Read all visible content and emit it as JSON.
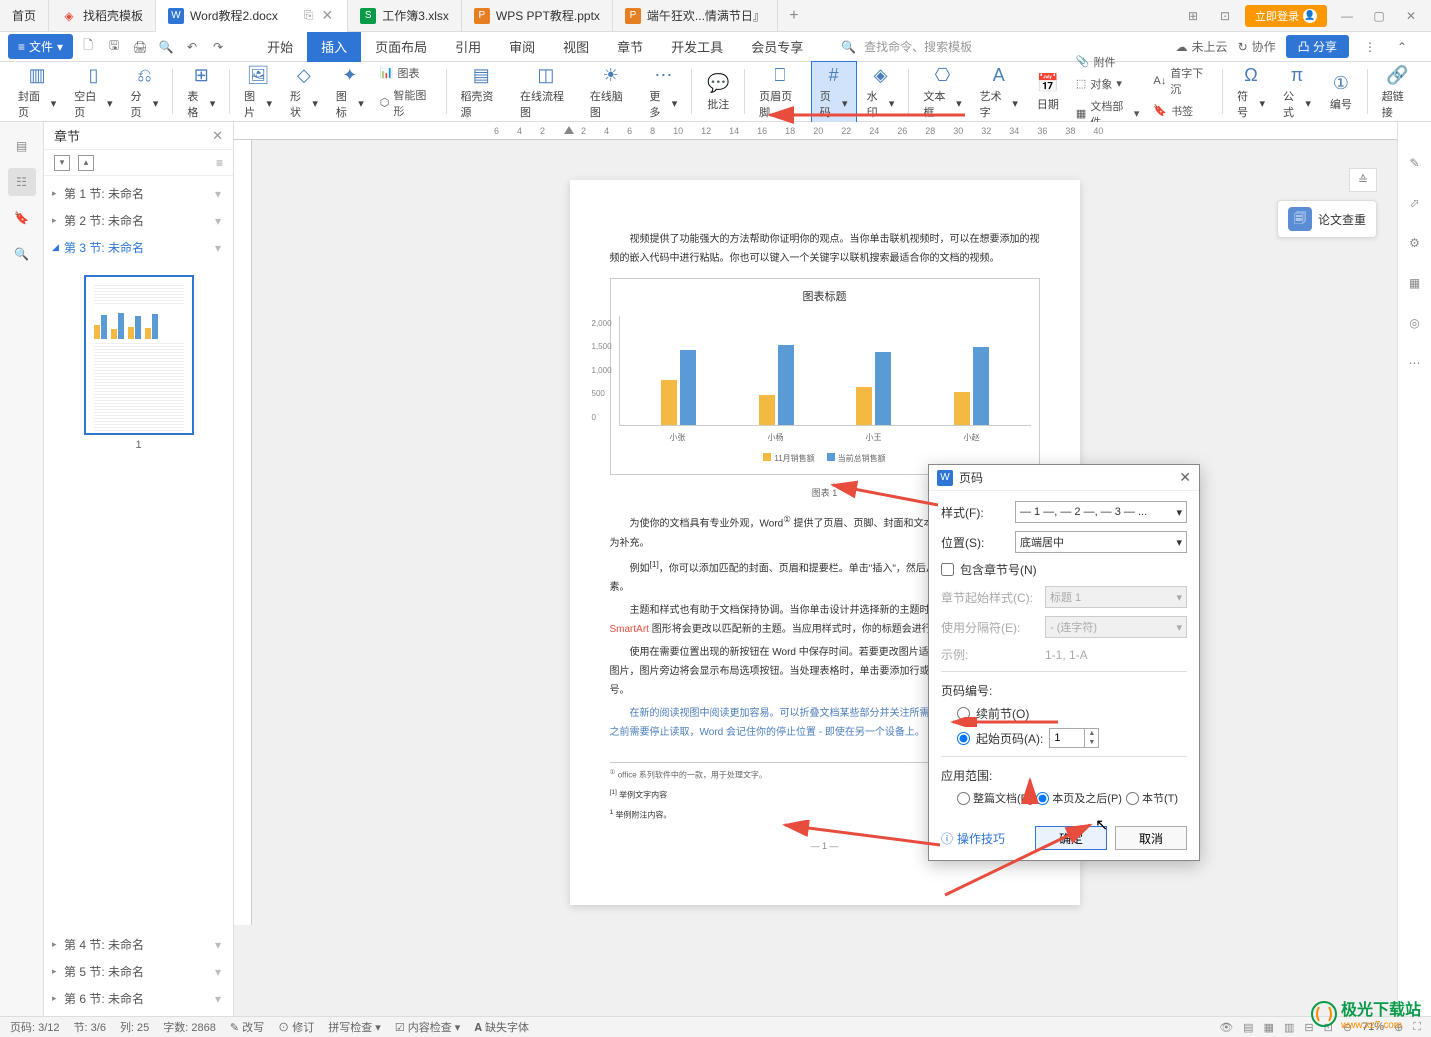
{
  "tabs": [
    {
      "label": "首页",
      "active": false
    },
    {
      "label": "找稻壳模板",
      "icon": "🔥",
      "iconColor": "#e74c3c",
      "active": false
    },
    {
      "label": "Word教程2.docx",
      "icon": "W",
      "iconColor": "#2e75d5",
      "active": true
    },
    {
      "label": "工作簿3.xlsx",
      "icon": "S",
      "iconColor": "#0a9b4a",
      "active": false
    },
    {
      "label": "WPS PPT教程.pptx",
      "icon": "P",
      "iconColor": "#e67e22",
      "active": false
    },
    {
      "label": "端午狂欢...情满节日』",
      "icon": "P",
      "iconColor": "#e67e22",
      "active": false
    }
  ],
  "login_label": "立即登录",
  "file_menu": "文件",
  "menu_tabs": [
    "开始",
    "插入",
    "页面布局",
    "引用",
    "审阅",
    "视图",
    "章节",
    "开发工具",
    "会员专享"
  ],
  "menu_active": "插入",
  "search_placeholder": "查找命令、搜索模板",
  "cloud": "未上云",
  "coop": "协作",
  "share": "分享",
  "ribbon": {
    "cover": "封面页",
    "blank": "空白页",
    "break": "分页",
    "table": "表格",
    "pic": "图片",
    "shape": "形状",
    "icon": "图标",
    "daokelib": "稻壳资源",
    "flowchart": "在线流程图",
    "mindmap": "在线脑图",
    "more": "更多",
    "comment": "批注",
    "header": "页眉页脚",
    "pagenum": "页码",
    "watermark": "水印",
    "textbox": "文本框",
    "wordart": "艺术字",
    "date": "日期",
    "attach": "附件",
    "object": "对象",
    "docparts": "文档部件",
    "bookmark": "书签",
    "link": "超链接",
    "firstdrop": "首字下沉",
    "symbol": "符号",
    "formula": "公式",
    "num": "编号",
    "smartart": "智能图形",
    "chart": "图表"
  },
  "sidebar": {
    "title": "章节",
    "sections": [
      {
        "label": "第 1 节: 未命名"
      },
      {
        "label": "第 2 节: 未命名"
      },
      {
        "label": "第 3 节: 未命名",
        "active": true
      },
      {
        "label": "第 4 节: 未命名"
      },
      {
        "label": "第 5 节: 未命名"
      },
      {
        "label": "第 6 节: 未命名"
      }
    ],
    "thumb_num": "1"
  },
  "doc": {
    "para1": "视频提供了功能强大的方法帮助你证明你的观点。当你单击联机视频时，可以在想要添加的视频的嵌入代码中进行粘贴。你也可以键入一个关键字以联机搜索最适合你的文档的视频。",
    "para2_a": "为使你的文档具有专业外观，Word",
    "para2_b": " 提供了页眉、页脚、封面和文本框设计，这些设计可互为补充。",
    "para3": "例如，你可以添加匹配的封面、页眉和提要栏。单击\"插入\"，然后从不同库中选择所需元素。",
    "para4": "主题和样式也有助于文档保持协调。当你单击设计并选择新的主题时，图片、图表或 SmartArt 图形将会更改以匹配新的主题。当应用样式时，你的标题会进行更改以匹配新的主题。",
    "para5": "使用在需要位置出现的新按钮在 Word 中保存时间。若要更改图片适应文档的方式，请单击该图片，图片旁边将会显示布局选项按钮。当处理表格时，单击要添加行或列的位置，然后单击加号。",
    "para6": "在新的阅读视图中阅读更加容易。可以折叠文档某些部分并关注所需文本。如果在达到结尾处之前需要停止读取，Word 会记住你的停止位置 - 即使在另一个设备上。",
    "footnote1": "office 系列软件中的一款，用于处理文字。",
    "footnote2": "举例文字内容",
    "footnote3": "举例附注内容。",
    "fig_caption": "图表 1",
    "page_num": "— 1 —"
  },
  "chart_data": {
    "type": "bar",
    "title": "图表标题",
    "categories": [
      "小张",
      "小杨",
      "小王",
      "小赵"
    ],
    "series": [
      {
        "name": "11月销售额",
        "values": [
          900,
          600,
          750,
          650
        ],
        "color": "#f4b942"
      },
      {
        "name": "当前总销售额",
        "values": [
          1500,
          1600,
          1450,
          1550
        ],
        "color": "#5b9bd5"
      }
    ],
    "ylim": [
      0,
      2000
    ],
    "yticks": [
      0,
      500,
      1000,
      1500,
      2000
    ]
  },
  "float_check": "论文查重",
  "dialog": {
    "title": "页码",
    "style_label": "样式(F):",
    "style_value": "— 1 —, — 2 —, — 3 — ...",
    "pos_label": "位置(S):",
    "pos_value": "底端居中",
    "include_chapter": "包含章节号(N)",
    "chapter_style_label": "章节起始样式(C):",
    "chapter_style_value": "标题 1",
    "separator_label": "使用分隔符(E):",
    "separator_value": "- (连字符)",
    "example_label": "示例:",
    "example_value": "1-1, 1-A",
    "numbering_hdr": "页码编号:",
    "continue_label": "续前节(O)",
    "start_label": "起始页码(A):",
    "start_value": "1",
    "scope_hdr": "应用范围:",
    "scope_whole": "整篇文档(D)",
    "scope_after": "本页及之后(P)",
    "scope_section": "本节(T)",
    "help": "操作技巧",
    "ok": "确定",
    "cancel": "取消"
  },
  "statusbar": {
    "page": "页码: 3/12",
    "section": "节: 3/6",
    "col": "列: 25",
    "words": "字数: 2868",
    "track": "改写",
    "revise": "修订",
    "spell": "拼写检查",
    "content": "内容检查",
    "font": "缺失字体",
    "zoom": "71%"
  },
  "ruler_marks": [
    "6",
    "4",
    "2",
    "",
    "2",
    "4",
    "6",
    "8",
    "10",
    "12",
    "14",
    "16",
    "18",
    "20",
    "22",
    "24",
    "26",
    "28",
    "30",
    "32",
    "34",
    "36",
    "38",
    "40"
  ],
  "watermark": {
    "name": "极光下载站",
    "url": "www.xz7.com"
  }
}
